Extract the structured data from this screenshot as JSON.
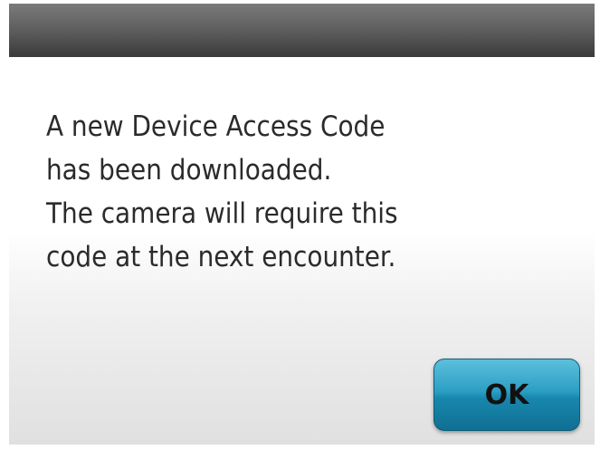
{
  "dialog": {
    "message_lines": [
      "A new Device Access Code",
      "has been downloaded.",
      "The camera will require this",
      "code at the next encounter."
    ],
    "ok_label": "OK"
  },
  "colors": {
    "title_bar": "#5a5a5a",
    "button": "#1c8db5",
    "text": "#2b2b2b"
  }
}
